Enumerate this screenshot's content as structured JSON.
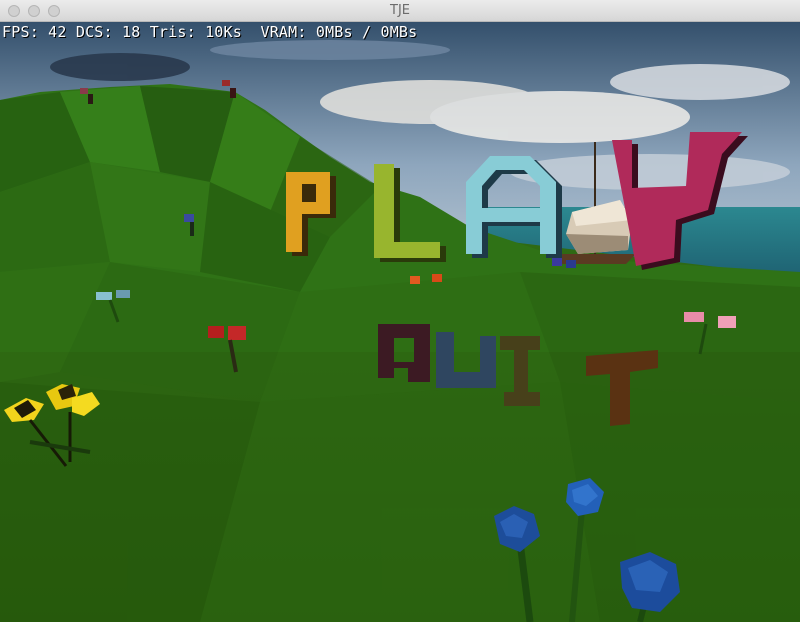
{
  "window": {
    "title": "TJE"
  },
  "hud": {
    "stats": "FPS: 42 DCS: 18 Tris: 10Ks  VRAM: 0MBs / 0MBs"
  },
  "menu": {
    "options": [
      {
        "label": "PLAY",
        "letter_colors": [
          "#e0a020",
          "#98b52e",
          "#88ccd6",
          "#b02a5a"
        ]
      },
      {
        "label": "QUIT",
        "letter_colors": [
          "#3c1a23",
          "#2f4660",
          "#47401a",
          "#5a3212"
        ]
      }
    ],
    "selected": "PLAY"
  },
  "scene": {
    "sky_color": "#8fa7c0",
    "sea_color": "#2f8f93",
    "grass_color": "#2c5e10",
    "flower_colors": [
      "#f2d41c",
      "#2360b8",
      "#c02020",
      "#e88ca8",
      "#88c0d0"
    ]
  }
}
